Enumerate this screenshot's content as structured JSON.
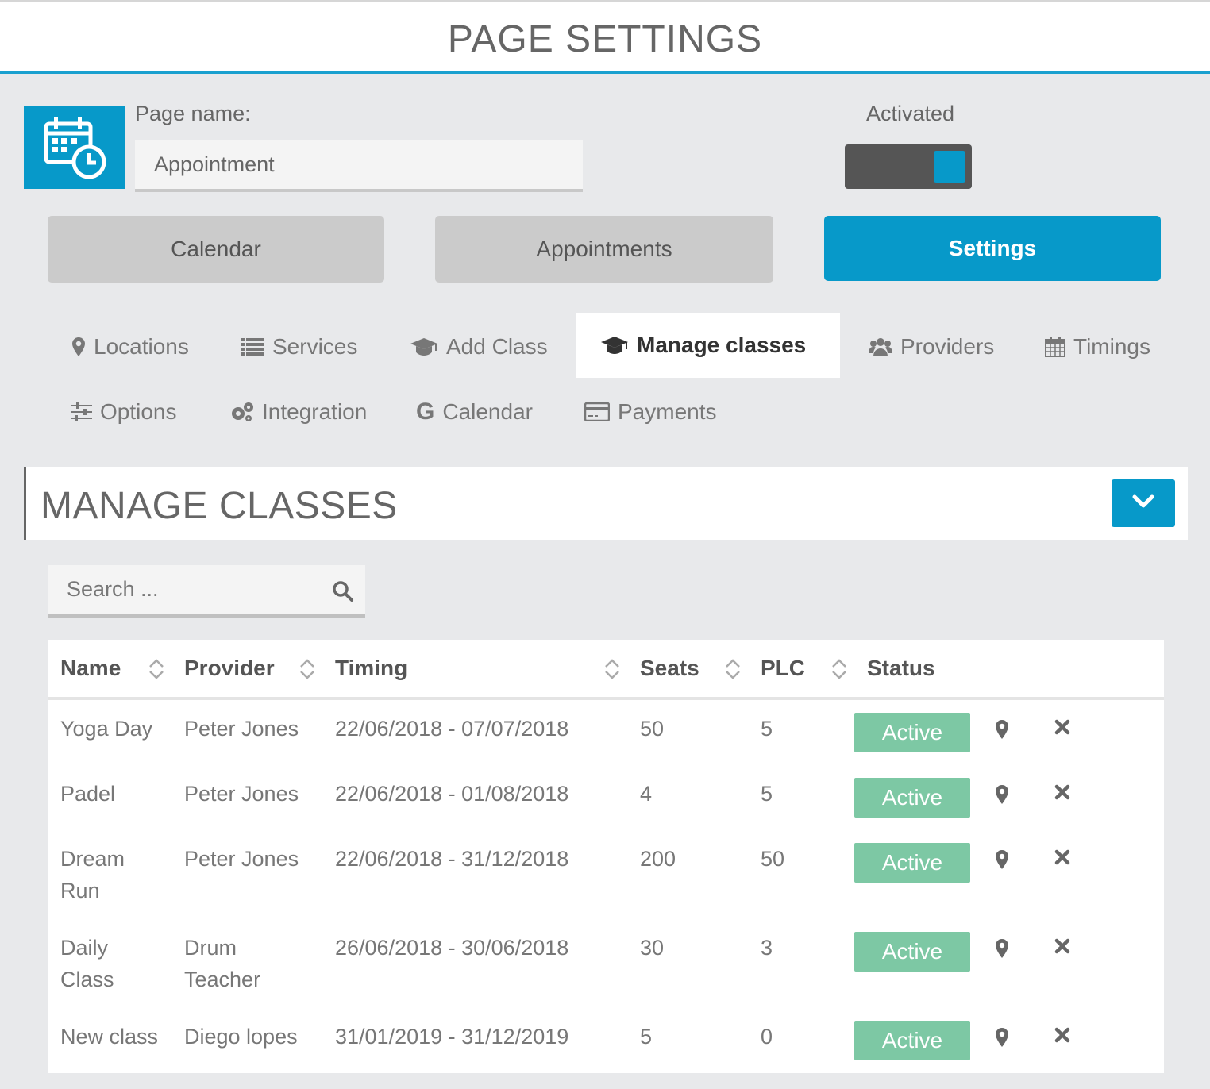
{
  "header": {
    "title": "PAGE SETTINGS"
  },
  "page": {
    "name_label": "Page name:",
    "name_value": "Appointment",
    "activated_label": "Activated",
    "activated": true
  },
  "main_buttons": [
    "Calendar",
    "Appointments",
    "Settings"
  ],
  "tabs": [
    "Locations",
    "Services",
    "Add Class",
    "Manage classes",
    "Providers",
    "Timings",
    "Options",
    "Integration",
    "Calendar",
    "Payments"
  ],
  "section": {
    "title": "MANAGE CLASSES"
  },
  "search": {
    "placeholder": "Search ..."
  },
  "table": {
    "headers": [
      "Name",
      "Provider",
      "Timing",
      "Seats",
      "PLC",
      "Status"
    ],
    "rows": [
      {
        "name": [
          "Yoga Day"
        ],
        "provider": [
          "Peter Jones"
        ],
        "timing": "22/06/2018 - 07/07/2018",
        "seats": "50",
        "plc": "5",
        "status": "Active"
      },
      {
        "name": [
          "Padel"
        ],
        "provider": [
          "Peter Jones"
        ],
        "timing": "22/06/2018 - 01/08/2018",
        "seats": "4",
        "plc": "5",
        "status": "Active"
      },
      {
        "name": [
          "Dream",
          "Run"
        ],
        "provider": [
          "Peter Jones"
        ],
        "timing": "22/06/2018 - 31/12/2018",
        "seats": "200",
        "plc": "50",
        "status": "Active"
      },
      {
        "name": [
          "Daily",
          "Class"
        ],
        "provider": [
          "Drum",
          "Teacher"
        ],
        "timing": "26/06/2018 - 30/06/2018",
        "seats": "30",
        "plc": "3",
        "status": "Active"
      },
      {
        "name": [
          "New class"
        ],
        "provider": [
          "Diego lopes"
        ],
        "timing": "31/01/2019 - 31/12/2019",
        "seats": "5",
        "plc": "0",
        "status": "Active"
      }
    ]
  },
  "colors": {
    "accent": "#0799c9",
    "active_badge": "#7dc8a4",
    "toggle_bg": "#555555"
  },
  "icons": [
    "calendar-clock-icon",
    "map-marker-icon",
    "list-icon",
    "graduation-cap-icon",
    "users-icon",
    "calendar-grid-icon",
    "sliders-icon",
    "cogs-icon",
    "google-icon",
    "credit-card-icon",
    "chevron-down-icon",
    "search-icon",
    "sort-icon",
    "close-icon"
  ]
}
